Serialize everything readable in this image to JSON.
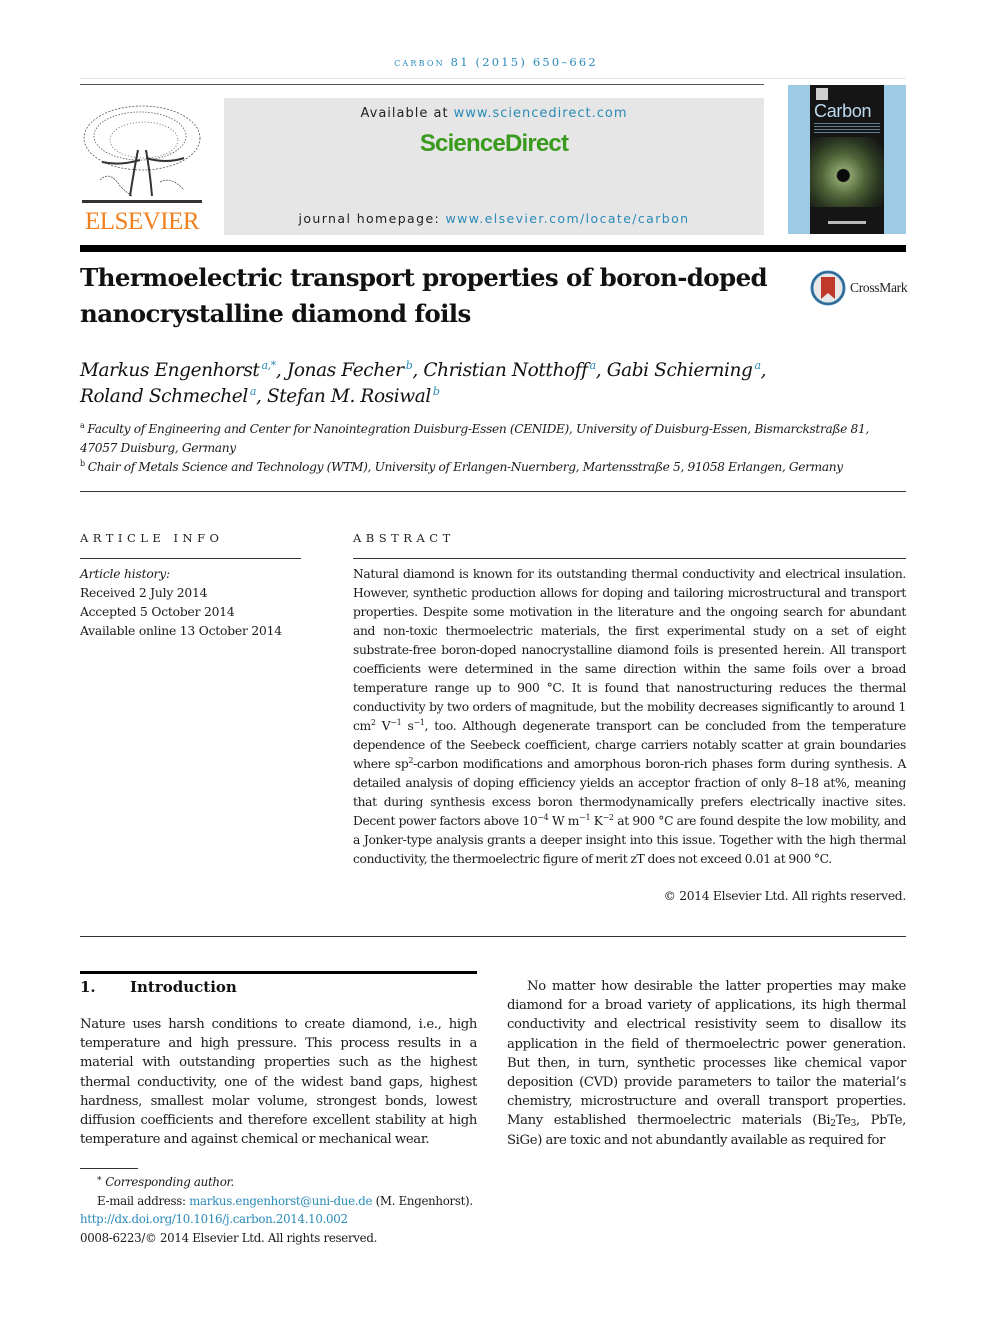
{
  "header": {
    "journal_ref_name": "carbon",
    "journal_ref_rest": "81 (2015) 650–662",
    "publisher_logo": "ELSEVIER",
    "available_prefix": "Available at ",
    "available_link": "www.sciencedirect.com",
    "platform_brand": "ScienceDirect",
    "homepage_prefix": "journal homepage: ",
    "homepage_link": "www.elsevier.com/locate/carbon",
    "cover_title": "Carbon",
    "crossmark_label": "CrossMark"
  },
  "article": {
    "title_line1": "Thermoelectric transport properties of boron-doped",
    "title_line2": "nanocrystalline diamond foils",
    "authors": [
      {
        "name": "Markus Engenhorst",
        "sup": "a,*"
      },
      {
        "name": "Jonas Fecher",
        "sup": "b"
      },
      {
        "name": "Christian Notthoff",
        "sup": "a"
      },
      {
        "name": "Gabi Schierning",
        "sup": "a"
      },
      {
        "name": "Roland Schmechel",
        "sup": "a"
      },
      {
        "name": "Stefan M. Rosiwal",
        "sup": "b"
      }
    ],
    "affiliations": [
      {
        "key": "a",
        "text": "Faculty of Engineering and Center for Nanointegration Duisburg-Essen (CENIDE), University of Duisburg-Essen, Bismarckstraße 81,",
        "text2": "47057 Duisburg, Germany"
      },
      {
        "key": "b",
        "text": "Chair of Metals Science and Technology (WTM), University of Erlangen-Nuernberg, Martensstraße 5, 91058 Erlangen, Germany"
      }
    ]
  },
  "article_info": {
    "label": "ARTICLE INFO",
    "history_heading": "Article history:",
    "received": "Received 2 July 2014",
    "accepted": "Accepted 5 October 2014",
    "online": "Available online 13 October 2014"
  },
  "abstract": {
    "label": "ABSTRACT",
    "p1": "Natural diamond is known for its outstanding thermal conductivity and electrical insulation. However, synthetic production allows for doping and tailoring microstructural and transport properties. Despite some motivation in the literature and the ongoing search for abundant and non-toxic thermoelectric materials, the first experimental study on a set of eight substrate-free boron-doped nanocrystalline diamond foils is presented herein. All transport coefficients were determined in the same direction within the same foils over a broad temperature range up to 900 °C. It is found that nanostructuring reduces the thermal conductivity by two orders of magnitude, but the mobility decreases significantly to around 1 cm",
    "sup_2a": "2",
    "p1b": " V",
    "sup_m1a": "−1",
    "p1c": " s",
    "sup_m1b": "−1",
    "p2": ", too. Although degenerate transport can be concluded from the temperature dependence of the Seebeck coefficient, charge carriers notably scatter at grain boundaries where sp",
    "sup_2b": "2",
    "p3": "-carbon modifications and amorphous boron-rich phases form during synthesis. A detailed analysis of doping efficiency yields an acceptor fraction of only 8–18 at%, meaning that during synthesis excess boron thermodynamically prefers electrically inactive sites. Decent power factors above 10",
    "sup_m4": "−4",
    "p3b": " W m",
    "sup_m1c": "−1",
    "p3c": " K",
    "sup_m2": "−2",
    "p4": " at 900 °C are found despite the low mobility, and a Jonker-type analysis grants a deeper insight into this issue. Together with the high thermal conductivity, the thermoelectric figure of merit zT does not exceed 0.01 at 900 °C.",
    "copyright": "© 2014 Elsevier Ltd. All rights reserved."
  },
  "introduction": {
    "number": "1.",
    "heading": "Introduction",
    "col1": "Nature uses harsh conditions to create diamond, i.e., high temperature and high pressure. This process results in a material with outstanding properties such as the highest thermal conductivity, one of the widest band gaps, highest hardness, smallest molar volume, strongest bonds, lowest diffusion coefficients and therefore excellent stability at high temperature and against chemical or mechanical wear.",
    "col2a": "No matter how desirable the latter properties may make diamond for a broad variety of applications, its high thermal conductivity and electrical resistivity seem to disallow its application in the field of thermoelectric power generation. But then, in turn, synthetic processes like chemical vapor deposition (CVD) provide parameters to tailor the material’s chemistry, microstructure and overall transport properties. Many established thermoelectric materials (Bi",
    "sub_2": "2",
    "col2b": "Te",
    "sub_3": "3",
    "col2c": ", PbTe, SiGe) are toxic and not abundantly available as required for"
  },
  "footnotes": {
    "star": "*",
    "corresponding": "Corresponding author.",
    "email_prefix": "E-mail address: ",
    "email": "markus.engenhorst@uni-due.de",
    "email_suffix": " (M. Engenhorst).",
    "doi": "http://dx.doi.org/10.1016/j.carbon.2014.10.002",
    "issn": "0008-6223/© 2014 Elsevier Ltd. All rights reserved."
  }
}
